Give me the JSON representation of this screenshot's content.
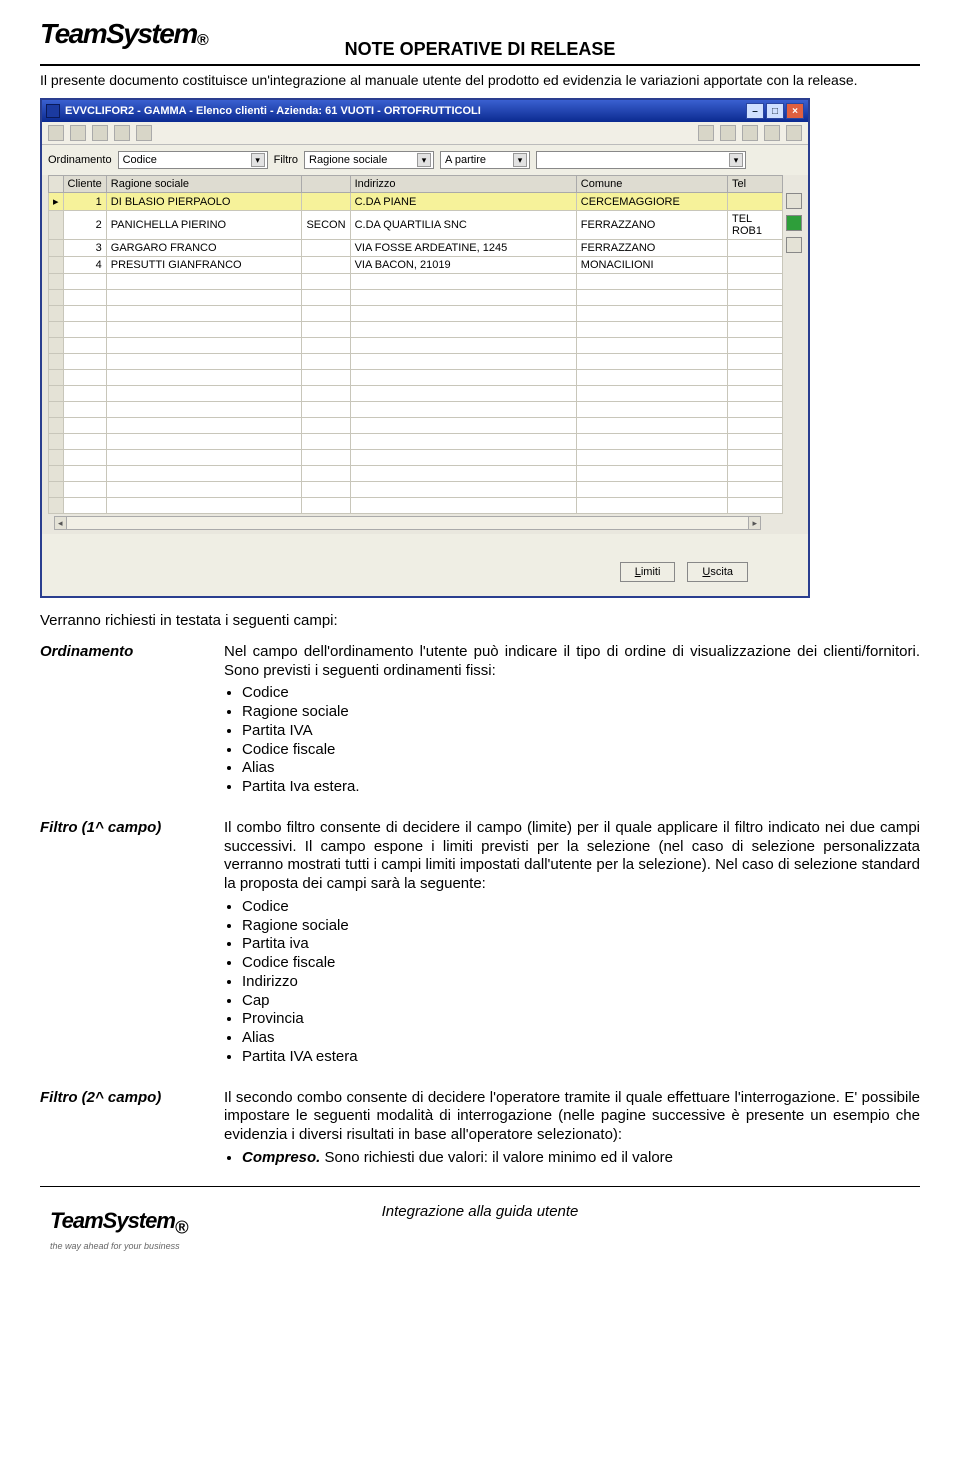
{
  "header": {
    "logo_text": "TeamSystem",
    "logo_reg": "®",
    "doc_title": "NOTE OPERATIVE DI RELEASE",
    "subtitle": "Il presente documento costituisce un'integrazione al manuale utente del prodotto ed evidenzia le variazioni apportate con la release."
  },
  "window": {
    "title": "EVVCLIFOR2 - GAMMA - Elenco clienti - Azienda:   61 VUOTI - ORTOFRUTTICOLI",
    "filters": {
      "ord_label": "Ordinamento",
      "ord_value": "Codice",
      "filtro_label": "Filtro",
      "filtro_value": "Ragione sociale",
      "op_value": "A partire",
      "search_value": ""
    },
    "columns": [
      "Cliente",
      "Ragione sociale",
      "",
      "Indirizzo",
      "Comune",
      "Tel"
    ],
    "rows": [
      {
        "n": "1",
        "rag": "DI BLASIO PIERPAOLO",
        "c2": "",
        "ind": "C.DA PIANE",
        "com": "CERCEMAGGIORE",
        "tel": "",
        "sel": true
      },
      {
        "n": "2",
        "rag": "PANICHELLA PIERINO",
        "c2": "SECON",
        "ind": "C.DA QUARTILIA SNC",
        "com": "FERRAZZANO",
        "tel": "TEL ROB1",
        "sel": false
      },
      {
        "n": "3",
        "rag": "GARGARO FRANCO",
        "c2": "",
        "ind": "VIA FOSSE ARDEATINE, 1245",
        "com": "FERRAZZANO",
        "tel": "",
        "sel": false
      },
      {
        "n": "4",
        "rag": "PRESUTTI GIANFRANCO",
        "c2": "",
        "ind": "VIA BACON, 21019",
        "com": "MONACILIONI",
        "tel": "",
        "sel": false
      }
    ],
    "empty_rows": 15,
    "buttons": {
      "limiti": "Limiti",
      "uscita": "Uscita"
    }
  },
  "body": {
    "intro": "Verranno richiesti in testata i seguenti campi:",
    "defs": [
      {
        "term": "Ordinamento",
        "text_before": "Nel campo dell'ordinamento l'utente può indicare il tipo di ordine di visualizzazione dei clienti/fornitori. Sono previsti i seguenti ordinamenti fissi:",
        "bullets": [
          "Codice",
          "Ragione sociale",
          "Partita IVA",
          "Codice fiscale",
          "Alias",
          "Partita Iva estera."
        ]
      },
      {
        "term": "Filtro (1^ campo)",
        "text_before": "Il combo filtro consente di decidere il campo (limite) per il quale applicare il filtro indicato nei due campi successivi. Il campo espone i limiti previsti per la selezione (nel caso di selezione personalizzata verranno mostrati tutti i campi limiti impostati dall'utente per la selezione). Nel caso di selezione standard la proposta dei campi sarà la seguente:",
        "bullets": [
          "Codice",
          "Ragione sociale",
          "Partita iva",
          "Codice fiscale",
          "Indirizzo",
          "Cap",
          "Provincia",
          "Alias",
          "Partita IVA estera"
        ]
      },
      {
        "term": "Filtro (2^ campo)",
        "text_before": "Il secondo combo consente di decidere l'operatore tramite il quale effettuare l'interrogazione. E' possibile  impostare le seguenti modalità di interrogazione (nelle pagine successive è presente un esempio che evidenzia i diversi risultati in base all'operatore selezionato):",
        "bullets": [],
        "trailing_html": "<b><i>Compreso.</i></b> Sono richiesti due valori: il valore minimo ed il valore"
      }
    ]
  },
  "footer": {
    "logo": "TeamSystem",
    "logo_reg": "®",
    "tagline": "the way ahead for your business",
    "text": "Integrazione alla guida utente"
  }
}
